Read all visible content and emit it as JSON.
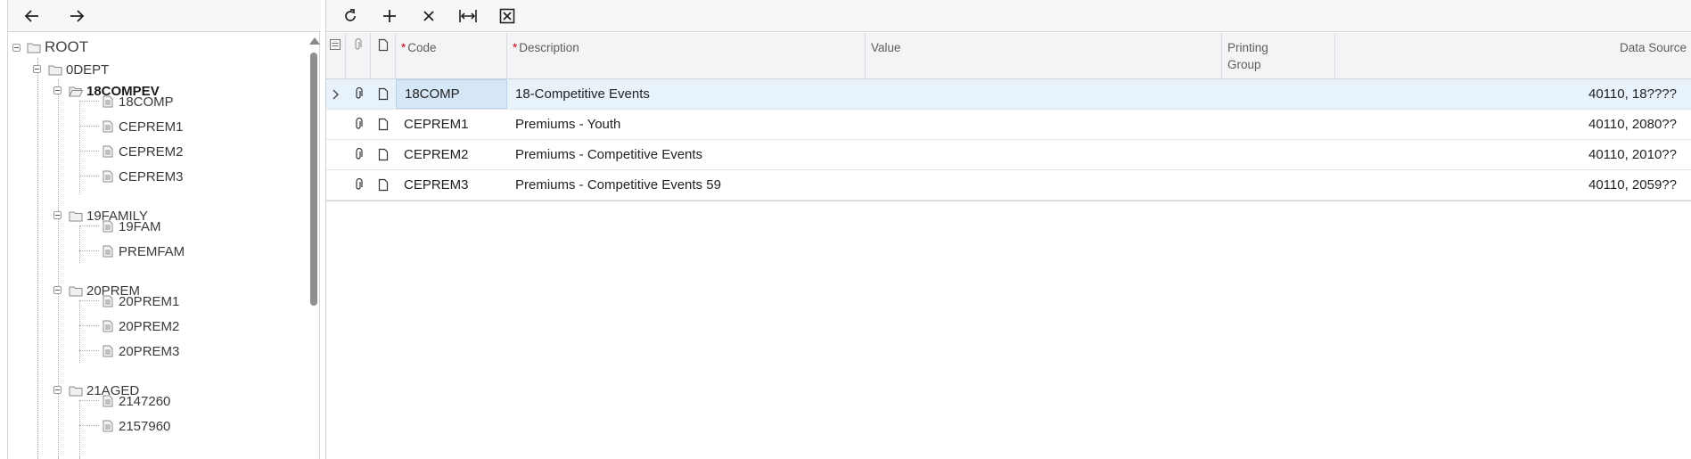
{
  "nav": {
    "back_icon": "arrow-left-icon",
    "forward_icon": "arrow-right-icon"
  },
  "tree": {
    "root": "ROOT",
    "dept": "0DEPT",
    "groups": [
      {
        "label": "18COMPEV",
        "active": true,
        "items": [
          "18COMP",
          "CEPREM1",
          "CEPREM2",
          "CEPREM3"
        ]
      },
      {
        "label": "19FAMILY",
        "active": false,
        "items": [
          "19FAM",
          "PREMFAM"
        ]
      },
      {
        "label": "20PREM",
        "active": false,
        "items": [
          "20PREM1",
          "20PREM2",
          "20PREM3"
        ]
      },
      {
        "label": "21AGED",
        "active": false,
        "items": [
          "2147260",
          "2157960"
        ]
      }
    ]
  },
  "toolbar": {
    "icons": [
      "refresh-icon",
      "add-icon",
      "delete-icon",
      "fit-columns-icon",
      "export-excel-icon"
    ]
  },
  "grid": {
    "columns": {
      "code": "Code",
      "description": "Description",
      "value": "Value",
      "printing_group_1": "Printing",
      "printing_group_2": "Group",
      "data_source": "Data Source"
    },
    "rows": [
      {
        "code": "18COMP",
        "description": "18-Competitive Events",
        "value": "",
        "printing_group": "",
        "data_source": "40110, 18????"
      },
      {
        "code": "CEPREM1",
        "description": "Premiums - Youth",
        "value": "",
        "printing_group": "",
        "data_source": "40110, 2080??"
      },
      {
        "code": "CEPREM2",
        "description": "Premiums - Competitive Events",
        "value": "",
        "printing_group": "",
        "data_source": "40110, 2010??"
      },
      {
        "code": "CEPREM3",
        "description": "Premiums - Competitive Events 59",
        "value": "",
        "printing_group": "",
        "data_source": "40110, 2059??"
      }
    ]
  },
  "colors": {
    "selected_row": "#e8f2fb",
    "selected_cell": "#d5e6f7",
    "required": "#d0021b"
  }
}
